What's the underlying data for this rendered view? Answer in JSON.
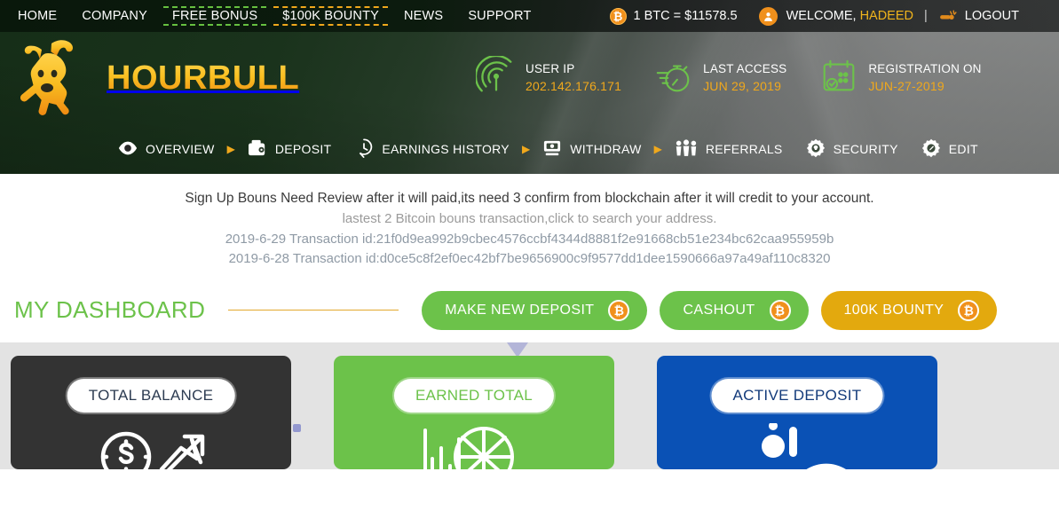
{
  "topnav": {
    "items": [
      {
        "label": "HOME",
        "style": "plain"
      },
      {
        "label": "COMPANY",
        "style": "plain"
      },
      {
        "label": "FREE BONUS",
        "style": "dashed-green"
      },
      {
        "label": "$100K BOUNTY",
        "style": "dashed-orange"
      },
      {
        "label": "NEWS",
        "style": "plain"
      },
      {
        "label": "SUPPORT",
        "style": "plain"
      }
    ],
    "btc_icon": "bitcoin-icon",
    "btc_price": "1 BTC = $11578.5",
    "user_icon": "user-icon",
    "welcome_prefix": "WELCOME,",
    "username": "HADEED",
    "divider": "|",
    "logout_icon": "logout-key-icon",
    "logout_label": "LOGOUT"
  },
  "brand": {
    "logo_icon": "bull-logo-icon",
    "name": "HOURBULL"
  },
  "info": [
    {
      "icon": "radar-signal-icon",
      "label": "USER IP",
      "value": "202.142.176.171"
    },
    {
      "icon": "stopwatch-icon",
      "label": "LAST ACCESS",
      "value": "JUN 29, 2019"
    },
    {
      "icon": "calendar-check-icon",
      "label": "REGISTRATION ON",
      "value": "JUN-27-2019"
    }
  ],
  "mainnav": {
    "separator": "▶",
    "items": [
      {
        "icon": "eye-icon",
        "label": "OVERVIEW",
        "sep_after": true
      },
      {
        "icon": "wallet-icon",
        "label": "DEPOSIT",
        "sep_after": false
      },
      {
        "icon": "clock-pin-icon",
        "label": "EARNINGS HISTORY",
        "sep_after": true
      },
      {
        "icon": "atm-cash-icon",
        "label": "WITHDRAW",
        "sep_after": true
      },
      {
        "icon": "people-group-icon",
        "label": "REFERRALS",
        "sep_after": false
      },
      {
        "icon": "gear-shield-icon",
        "label": "SECURITY",
        "sep_after": false
      },
      {
        "icon": "gear-edit-icon",
        "label": "EDIT",
        "sep_after": false
      }
    ]
  },
  "notice": {
    "line1": "Sign Up Bouns Need Review after it will paid,its need 3 confirm from blockchain after it will credit to your account.",
    "line2": "lastest 2 Bitcoin bouns transaction,click to search your address.",
    "tx1": "2019-6-29 Transaction id:21f0d9ea992b9cbec4576ccbf4344d8881f2e91668cb51e234bc62caa955959b",
    "tx2": "2019-6-28 Transaction id:d0ce5c8f2ef0ec42bf7be9656900c9f9577dd1dee1590666a97a49af110c8320"
  },
  "dashboard": {
    "title": "MY DASHBOARD",
    "buttons": [
      {
        "label": "MAKE NEW DEPOSIT",
        "color": "green",
        "coin": "bitcoin-icon"
      },
      {
        "label": "CASHOUT",
        "color": "green",
        "coin": "bitcoin-icon"
      },
      {
        "label": "100K BOUNTY",
        "color": "gold",
        "coin": "bitcoin-icon"
      }
    ]
  },
  "cards": [
    {
      "label": "TOTAL BALANCE",
      "theme": "dark",
      "icon": "dollar-growth-icon"
    },
    {
      "label": "EARNED TOTAL",
      "theme": "green",
      "icon": "bar-chart-globe-icon"
    },
    {
      "label": "ACTIVE DEPOSIT",
      "theme": "blue",
      "icon": "coin-stack-icon"
    }
  ],
  "colors": {
    "brand_green": "#6cc24a",
    "brand_orange": "#f0a81c",
    "brand_gold": "#e3a90e",
    "card_dark": "#333333",
    "card_blue": "#0a51b5",
    "header_green": "#142d16",
    "page_gray": "#e3e3e3",
    "pointer_lavender": "#b3b5d8"
  }
}
